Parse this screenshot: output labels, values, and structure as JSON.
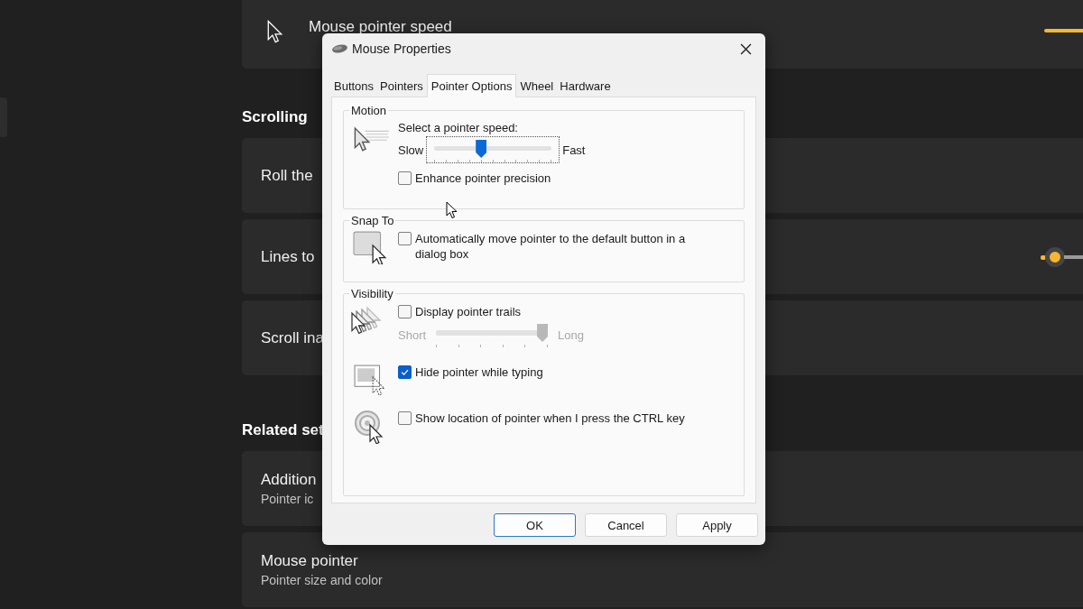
{
  "background": {
    "top_card": {
      "title": "Mouse pointer speed"
    },
    "sections": [
      {
        "heading": "Scrolling",
        "cards": [
          {
            "title": "Roll the"
          },
          {
            "title": "Lines to"
          },
          {
            "title": "Scroll ina"
          }
        ]
      },
      {
        "heading": "Related set",
        "cards": [
          {
            "title": "Addition",
            "subtitle": "Pointer ic"
          },
          {
            "title": "Mouse pointer",
            "subtitle": "Pointer size and color"
          }
        ]
      }
    ]
  },
  "dialog": {
    "title": "Mouse Properties",
    "tabs": [
      {
        "label": "Buttons",
        "selected": false
      },
      {
        "label": "Pointers",
        "selected": false
      },
      {
        "label": "Pointer Options",
        "selected": true
      },
      {
        "label": "Wheel",
        "selected": false
      },
      {
        "label": "Hardware",
        "selected": false
      }
    ],
    "motion": {
      "title": "Motion",
      "speed_label": "Select a pointer speed:",
      "slider": {
        "min_label": "Slow",
        "max_label": "Fast",
        "level": 0.4,
        "disabled": false
      },
      "precision": {
        "label": "Enhance pointer precision",
        "checked": false
      }
    },
    "snap_to": {
      "title": "Snap To",
      "auto_snap": {
        "label": "Automatically move pointer to the default button in a dialog box",
        "checked": false
      }
    },
    "visibility": {
      "title": "Visibility",
      "trails": {
        "label": "Display pointer trails",
        "checked": false
      },
      "trail_slider": {
        "min_label": "Short",
        "max_label": "Long",
        "level": 1,
        "disabled": true
      },
      "hide_typing": {
        "label": "Hide pointer while typing",
        "checked": true
      },
      "ctrl_locate": {
        "label": "Show location of pointer when I press the CTRL key",
        "checked": false
      }
    },
    "buttons": [
      {
        "label": "OK",
        "default": true
      },
      {
        "label": "Cancel",
        "default": false
      },
      {
        "label": "Apply",
        "default": false
      }
    ]
  }
}
